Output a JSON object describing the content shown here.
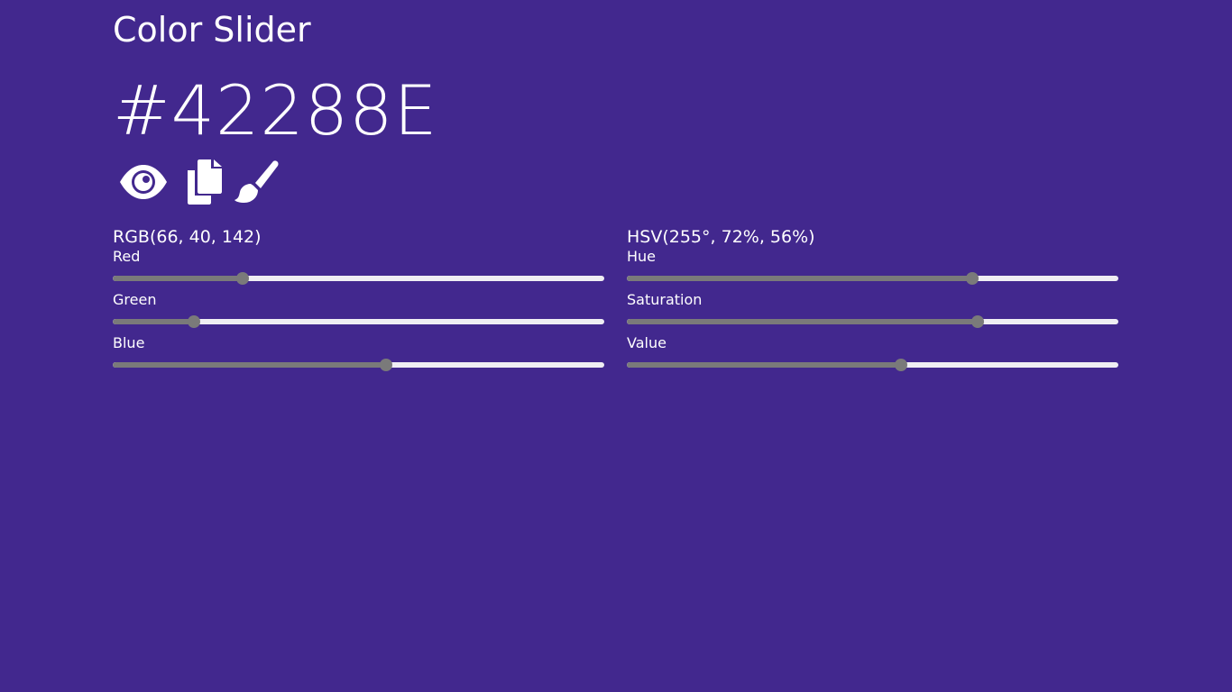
{
  "app": {
    "title": "Color Slider",
    "hex": "#42288E",
    "background": "#42288E"
  },
  "actions": [
    {
      "icon": "eye-icon"
    },
    {
      "icon": "copy-icon"
    },
    {
      "icon": "paint-brush-icon"
    }
  ],
  "rgb": {
    "heading": "RGB(66, 40, 142)",
    "sliders": [
      {
        "label": "Red",
        "value": 66,
        "max": 255
      },
      {
        "label": "Green",
        "value": 40,
        "max": 255
      },
      {
        "label": "Blue",
        "value": 142,
        "max": 255
      }
    ]
  },
  "hsv": {
    "heading": "HSV(255°, 72%, 56%)",
    "sliders": [
      {
        "label": "Hue",
        "value": 255,
        "max": 360
      },
      {
        "label": "Saturation",
        "value": 72,
        "max": 100
      },
      {
        "label": "Value",
        "value": 56,
        "max": 100
      }
    ]
  },
  "colors": {
    "slider_fill": "#7a7a7a",
    "slider_track": "#efeef3",
    "icon": "#ffffff"
  }
}
